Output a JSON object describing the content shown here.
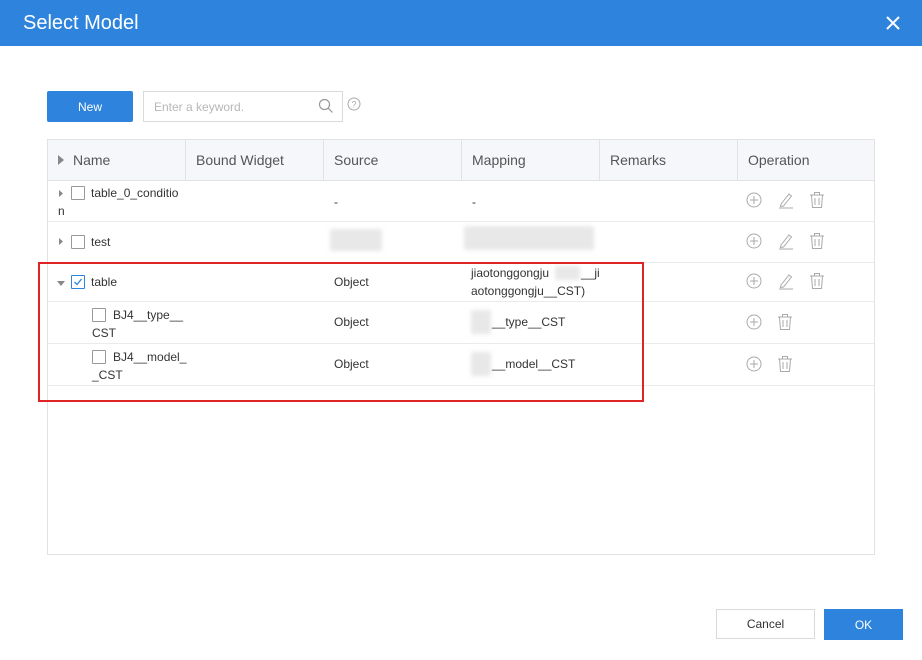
{
  "dialog": {
    "title": "Select Model",
    "close_icon": "close-icon"
  },
  "toolbar": {
    "new_label": "New",
    "search_placeholder": "Enter a keyword.",
    "search_icon": "search-icon",
    "help_icon": "help-icon"
  },
  "table": {
    "columns": [
      "Name",
      "Bound Widget",
      "Source",
      "Mapping",
      "Remarks",
      "Operation"
    ],
    "rows": [
      {
        "name_line1": "table_0_conditio",
        "name_line2": "n",
        "source": "-",
        "mapping": "-",
        "checked": false,
        "expanded": false
      },
      {
        "name_line1": "test",
        "source": "",
        "mapping": "",
        "checked": false,
        "expanded": false
      },
      {
        "name_line1": "table",
        "source": "Object",
        "mapping_line1": "jiaotonggongju",
        "mapping_line1b": "__ji",
        "mapping_line2": "aotonggongju__CST)",
        "checked": true,
        "expanded": true
      },
      {
        "name_line1": "BJ4__type__",
        "name_line2": "CST",
        "source": "Object",
        "mapping": "__type__CST",
        "checked": false,
        "child": true
      },
      {
        "name_line1": "BJ4__model_",
        "name_line2": "_CST",
        "source": "Object",
        "mapping": "__model__CST",
        "checked": false,
        "child": true
      }
    ],
    "operation_icons": [
      "add-icon",
      "edit-icon",
      "delete-icon"
    ]
  },
  "footer": {
    "cancel_label": "Cancel",
    "ok_label": "OK"
  },
  "colors": {
    "primary": "#2e84dd",
    "highlight": "#e02424"
  }
}
